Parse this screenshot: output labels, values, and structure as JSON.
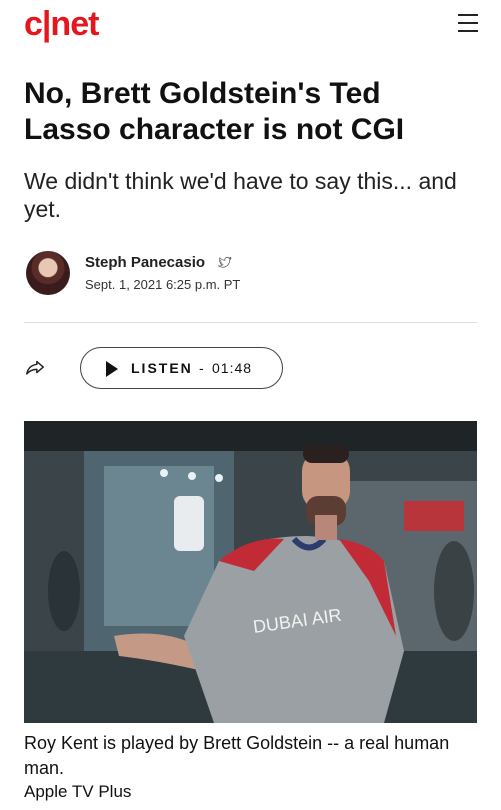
{
  "header": {
    "logo_text": "c|net",
    "menu_icon": "hamburger-menu-icon",
    "brand_color": "#e4171f"
  },
  "article": {
    "headline": "No, Brett Goldstein's Ted Lasso character is not CGI",
    "dek": "We didn't think we'd have to say this... and yet.",
    "author": "Steph Panecasio",
    "author_social_icon": "twitter-icon",
    "date": "Sept. 1, 2021 6:25 p.m. PT"
  },
  "audio": {
    "share_icon": "share-arrow-icon",
    "label": "LISTEN",
    "separator": "-",
    "duration": "01:48",
    "play_icon": "play-icon"
  },
  "photo": {
    "jersey_text": "DUBAI AIR"
  },
  "caption": {
    "text": "Roy Kent is played by Brett Goldstein -- a real human man.",
    "credit": "Apple TV Plus"
  }
}
